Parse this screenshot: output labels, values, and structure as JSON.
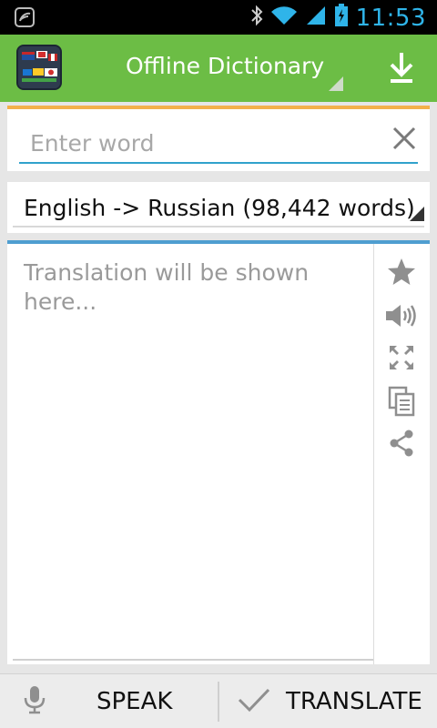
{
  "status_bar": {
    "time": "11:53",
    "icons": [
      "notification-icon",
      "bluetooth-icon",
      "wifi-icon",
      "signal-icon",
      "battery-charging-icon"
    ]
  },
  "action_bar": {
    "title": "Offline Dictionary",
    "app_icon": "app-flags-icon",
    "download_icon": "download-icon"
  },
  "word_input": {
    "value": "",
    "placeholder": "Enter word",
    "clear_icon": "close-icon"
  },
  "language": {
    "selected": "English -> Russian (98,442 words)"
  },
  "translation": {
    "placeholder": "Translation will be shown here...",
    "actions": [
      "star-icon",
      "speaker-icon",
      "fullscreen-icon",
      "copy-icon",
      "share-icon"
    ]
  },
  "bottom_bar": {
    "speak_label": "SPEAK",
    "translate_label": "TRANSLATE"
  },
  "colors": {
    "action_bar": "#6cbd45",
    "input_accent": "#f3b04a",
    "translation_accent": "#4f9ed0",
    "field_underline": "#31a2cc",
    "clock": "#2fb4e9"
  }
}
